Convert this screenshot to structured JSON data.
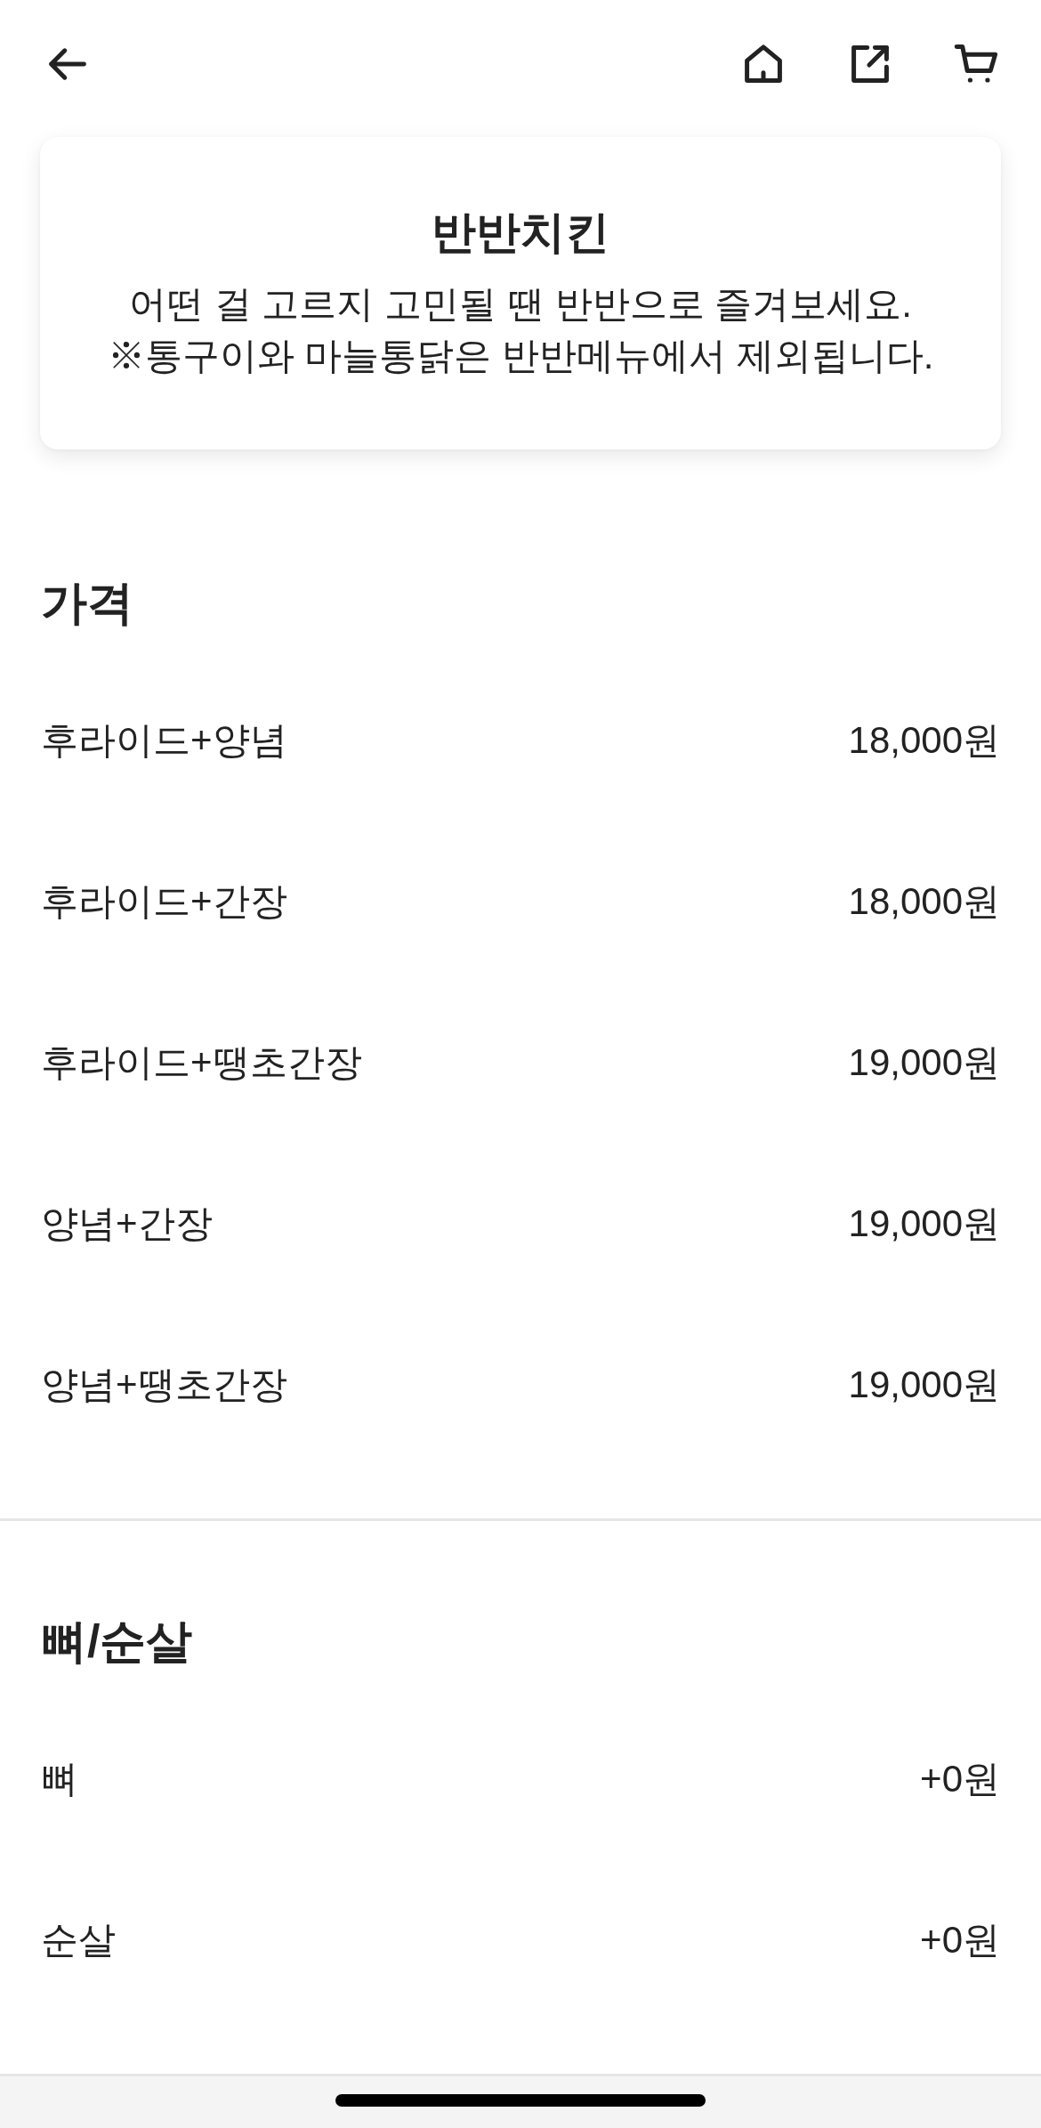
{
  "menu_card": {
    "title": "반반치킨",
    "description": [
      "어떤 걸 고르지 고민될 땐 반반으로 즐겨보세요.",
      "※통구이와 마늘통닭은 반반메뉴에서 제외됩니다."
    ]
  },
  "sections": [
    {
      "title": "가격",
      "options": [
        {
          "name": "후라이드+양념",
          "price": "18,000원"
        },
        {
          "name": "후라이드+간장",
          "price": "18,000원"
        },
        {
          "name": "후라이드+땡초간장",
          "price": "19,000원"
        },
        {
          "name": "양념+간장",
          "price": "19,000원"
        },
        {
          "name": "양념+땡초간장",
          "price": "19,000원"
        }
      ]
    },
    {
      "title": "뼈/순살",
      "options": [
        {
          "name": "뼈",
          "price": "+0원"
        },
        {
          "name": "순살",
          "price": "+0원"
        }
      ]
    }
  ]
}
